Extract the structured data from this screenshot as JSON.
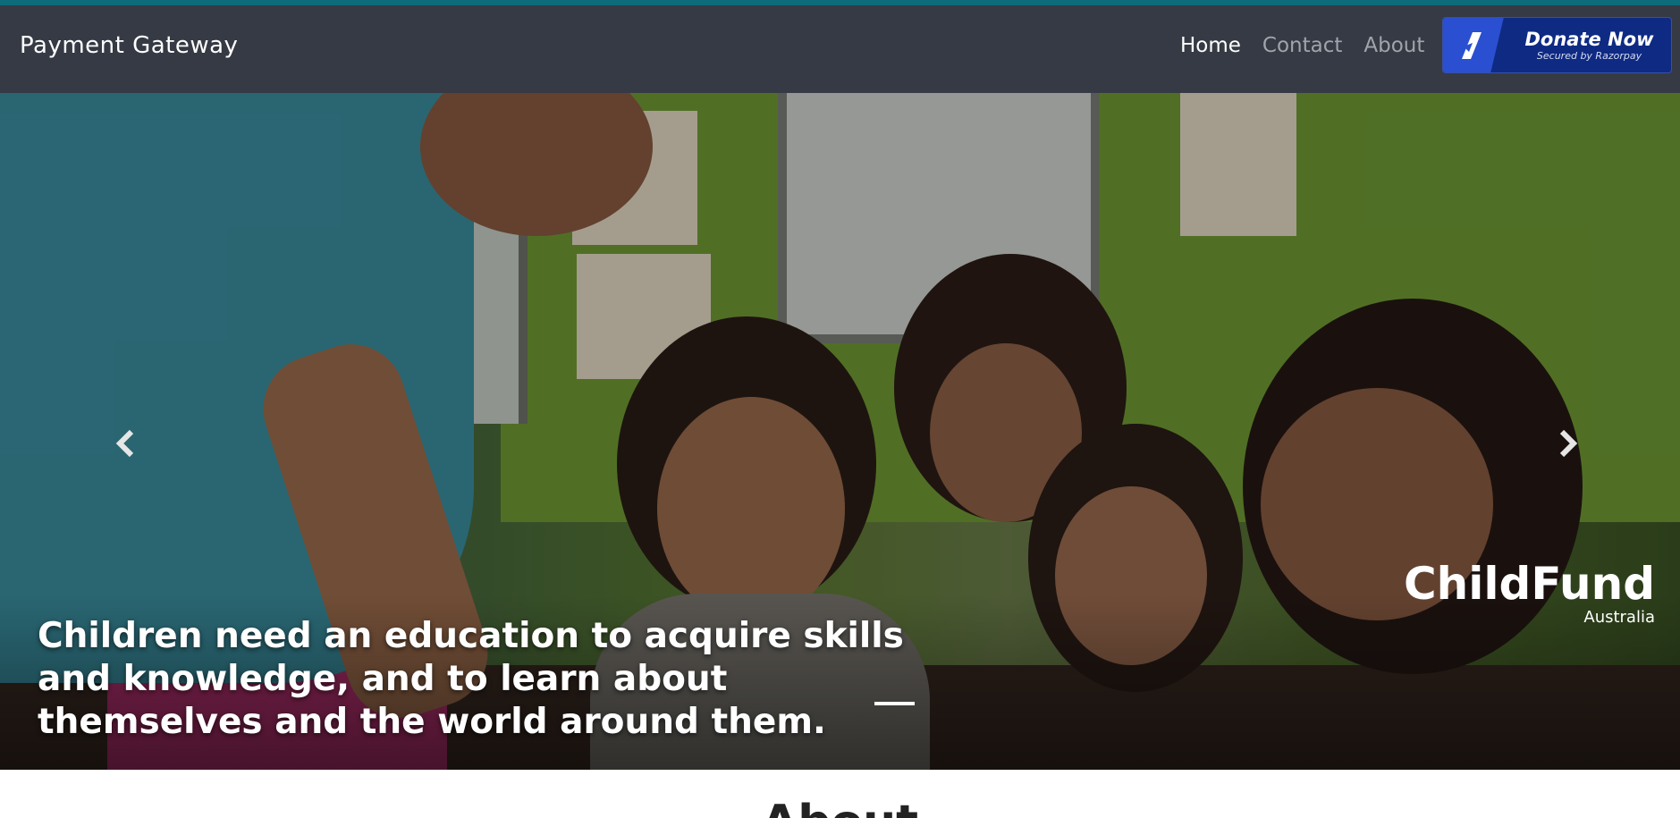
{
  "navbar": {
    "brand": "Payment Gateway",
    "links": [
      {
        "label": "Home",
        "active": true
      },
      {
        "label": "Contact",
        "active": false
      },
      {
        "label": "About",
        "active": false
      }
    ],
    "donate": {
      "label": "Donate Now",
      "sublabel": "Secured by Razorpay",
      "icon": "razorpay-logo-icon"
    }
  },
  "carousel": {
    "caption": "Children need an education to acquire skills and knowledge, and to learn about themselves and the world around them.",
    "watermark": {
      "main": "ChildFund",
      "sub": "Australia"
    },
    "prev_icon": "chevron-left-icon",
    "next_icon": "chevron-right-icon"
  },
  "about": {
    "heading": "About"
  },
  "colors": {
    "navbar_bg": "#353a44",
    "accent_bar": "#0e6b7a",
    "donate_bg": "#0f2a83",
    "donate_logo": "#2a4fd0"
  }
}
